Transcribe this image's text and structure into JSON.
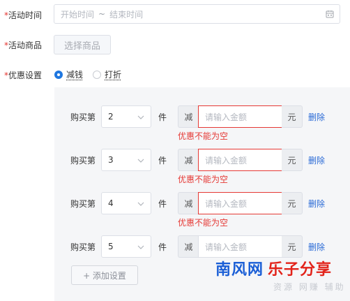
{
  "form": {
    "activity_time": {
      "label": "活动时间",
      "start_placeholder": "开始时间",
      "separator": "~",
      "end_placeholder": "结束时间"
    },
    "activity_goods": {
      "label": "活动商品",
      "button": "选择商品"
    },
    "discount": {
      "label": "优惠设置",
      "options": [
        {
          "label": "减钱",
          "checked": true
        },
        {
          "label": "打折",
          "checked": false
        }
      ]
    }
  },
  "tiers": [
    {
      "buy_label": "购买第",
      "number": "2",
      "unit": "件",
      "reduce": "减",
      "amount_placeholder": "请输入金额",
      "currency": "元",
      "delete": "删除",
      "error": "优惠不能为空"
    },
    {
      "buy_label": "购买第",
      "number": "3",
      "unit": "件",
      "reduce": "减",
      "amount_placeholder": "请输入金额",
      "currency": "元",
      "delete": "删除",
      "error": "优惠不能为空"
    },
    {
      "buy_label": "购买第",
      "number": "4",
      "unit": "件",
      "reduce": "减",
      "amount_placeholder": "请输入金额",
      "currency": "元",
      "delete": "删除",
      "error": "优惠不能为空"
    },
    {
      "buy_label": "购买第",
      "number": "5",
      "unit": "件",
      "reduce": "减",
      "amount_placeholder": "请输入金额",
      "currency": "元",
      "delete": "删除",
      "error": ""
    }
  ],
  "add_setting": "+ 添加设置",
  "watermark": {
    "part1": "南风网",
    "part2": "乐子分享",
    "sub": "资源 网赚 辅助"
  },
  "colors": {
    "primary": "#1f77e0",
    "error": "#e53935",
    "link": "#2a6ad6"
  }
}
